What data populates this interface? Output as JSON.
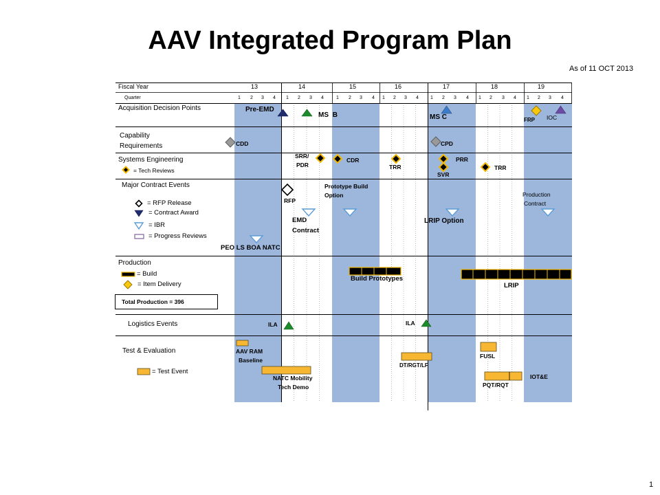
{
  "title": "AAV Integrated Program Plan",
  "as_of": "As of 11 OCT 2013",
  "page_number": "1",
  "colors": {
    "column_shade": "#9db7dc",
    "test_event": "#f7b733",
    "tech_review_outline": "#f2b800",
    "item_delivery": "#f9c80e",
    "milestone_navy": "#1f2d6e",
    "milestone_green": "#1d8b2b",
    "milestone_blue": "#3d7cc9",
    "milestone_purple": "#6b4ba3",
    "ibr_outline": "#5b9bd5",
    "progress_review_outline": "#8064a2",
    "document_gray": "#9a9a9a"
  },
  "header": {
    "fiscal_year_label": "Fiscal Year",
    "quarter_label": "Quarter",
    "years": [
      "13",
      "14",
      "15",
      "16",
      "17",
      "18",
      "19"
    ],
    "quarters": [
      "1",
      "2",
      "3",
      "4"
    ]
  },
  "acquisition": {
    "label": "Acquisition Decision Points",
    "events": {
      "pre_emd": "Pre-EMD",
      "ms_b": "MS B",
      "ms_c": "MS C",
      "frp": "FRP",
      "ioc": "IOC"
    }
  },
  "capability": {
    "label_line1": "Capability",
    "label_line2": "Requirements",
    "events": {
      "cdd": "CDD",
      "cpd": "CPD"
    }
  },
  "systems_engineering": {
    "label": "Systems Engineering",
    "legend_tech_reviews": "= Tech Reviews",
    "events": {
      "srr_pdr_line1": "SRR/",
      "srr_pdr_line2": "PDR",
      "cdr": "CDR",
      "trr_1": "TRR",
      "prr": "PRR",
      "svr": "SVR",
      "trr_2": "TRR"
    }
  },
  "contracts": {
    "label": "Major Contract Events",
    "legend": {
      "rfp_release": "= RFP Release",
      "contract_award": "= Contract Award",
      "ibr": "= IBR",
      "progress_reviews": "= Progress Reviews"
    },
    "events": {
      "rfp": "RFP",
      "prototype_build_line1": "Prototype Build",
      "prototype_build_line2": "Option",
      "emd_line1": "EMD",
      "emd_line2": "Contract",
      "lrip_option": "LRIP Option",
      "production_contract_line1": "Production",
      "production_contract_line2": "Contract",
      "peo_ls_boa_natc": "PEO LS BOA NATC"
    }
  },
  "production": {
    "label": "Production",
    "legend": {
      "build": "= Build",
      "item_delivery": "= Item Delivery"
    },
    "total": "Total Production = 396",
    "events": {
      "build_prototypes": "Build Prototypes",
      "lrip": "LRIP"
    }
  },
  "logistics": {
    "label": "Logistics Events",
    "events": {
      "ila_1": "ILA",
      "ila_2": "ILA"
    }
  },
  "test_evaluation": {
    "label": "Test & Evaluation",
    "legend_test_event": "= Test Event",
    "events": {
      "aav_ram_line1": "AAV RAM",
      "aav_ram_line2": "Baseline",
      "natc_line1": "NATC Mobility",
      "natc_line2": "Tech Demo",
      "dt_rgt_lf": "DT/RGT/LF",
      "fusl": "FUSL",
      "pqt_rqt": "PQT/RQT",
      "iot_e": "IOT&E"
    }
  }
}
